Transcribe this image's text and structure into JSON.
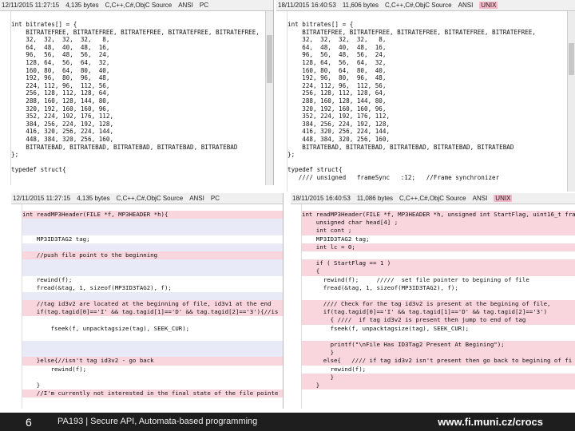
{
  "top_left": {
    "status": {
      "date": "12/11/2015 11:27:15",
      "size": "4,135 bytes",
      "encoding": "C,C++,C#,ObjC Source",
      "charset": "ANSI",
      "eol": "PC"
    },
    "lines": [
      "int bitrates[] = {",
      "    BITRATEFREE, BITRATEFREE, BITRATEFREE, BITRATEFREE, BITRATEFREE,",
      "    32,  32,  32,  32,   8,",
      "    64,  48,  40,  48,  16,",
      "    96,  56,  48,  56,  24,",
      "    128, 64,  56,  64,  32,",
      "    160, 80,  64,  80,  40,",
      "    192, 96,  80,  96,  48,",
      "    224, 112, 96,  112, 56,",
      "    256, 128, 112, 128, 64,",
      "    288, 160, 128, 144, 80,",
      "    320, 192, 160, 160, 96,",
      "    352, 224, 192, 176, 112,",
      "    384, 256, 224, 192, 128,",
      "    416, 320, 256, 224, 144,",
      "    448, 384, 320, 256, 160,",
      "    BITRATEBAD, BITRATEBAD, BITRATEBAD, BITRATEBAD, BITRATEBAD",
      "};",
      "",
      "typedef struct{"
    ]
  },
  "top_right": {
    "status": {
      "date": "18/11/2015 16:40:53",
      "size": "11,606 bytes",
      "encoding": "C,C++,C#,ObjC Source",
      "charset": "ANSI",
      "eol": "UNIX"
    },
    "lines": [
      "int bitrates[] = {",
      "    BITRATEFREE, BITRATEFREE, BITRATEFREE, BITRATEFREE, BITRATEFREE,",
      "    32,  32,  32,  32,   8,",
      "    64,  48,  40,  48,  16,",
      "    96,  56,  48,  56,  24,",
      "    128, 64,  56,  64,  32,",
      "    160, 80,  64,  80,  40,",
      "    192, 96,  80,  96,  48,",
      "    224, 112, 96,  112, 56,",
      "    256, 128, 112, 128, 64,",
      "    288, 160, 128, 144, 80,",
      "    320, 192, 160, 160, 96,",
      "    352, 224, 192, 176, 112,",
      "    384, 256, 224, 192, 128,",
      "    416, 320, 256, 224, 144,",
      "    448, 384, 320, 256, 160,",
      "    BITRATEBAD, BITRATEBAD, BITRATEBAD, BITRATEBAD, BITRATEBAD",
      "};",
      "",
      "typedef struct{",
      "   //// unsigned   frameSync   :12;   //Frame synchronizer"
    ]
  },
  "bottom_left": {
    "status": {
      "date": "12/11/2015 11:27:15",
      "size": "4,135 bytes",
      "encoding": "C,C++,C#,ObjC Source",
      "charset": "ANSI",
      "eol": "PC"
    },
    "lines": [
      {
        "t": "int readMP3Header(FILE *f, MP3HEADER *h){",
        "c": "diff"
      },
      {
        "t": "",
        "c": "blank"
      },
      {
        "t": "",
        "c": "blank"
      },
      {
        "t": "    MP3ID3TAG2 tag;",
        "c": ""
      },
      {
        "t": "",
        "c": "blank"
      },
      {
        "t": "    //push file point to the beginning",
        "c": "diff"
      },
      {
        "t": "",
        "c": "blank"
      },
      {
        "t": "",
        "c": "blank"
      },
      {
        "t": "    rewind(f);",
        "c": ""
      },
      {
        "t": "    fread(&tag, 1, sizeof(MP3ID3TAG2), f);",
        "c": ""
      },
      {
        "t": "",
        "c": "blank"
      },
      {
        "t": "    //tag id3v2 are located at the beginning of file, id3v1 at the end",
        "c": "diff"
      },
      {
        "t": "    if(tag.tagid[0]=='I' && tag.tagid[1]=='D' && tag.tagid[2]=='3'){//is",
        "c": "diff"
      },
      {
        "t": "",
        "c": ""
      },
      {
        "t": "        fseek(f, unpacktagsize(tag), SEEK_CUR);",
        "c": ""
      },
      {
        "t": "",
        "c": ""
      },
      {
        "t": "",
        "c": "blank"
      },
      {
        "t": "",
        "c": "blank"
      },
      {
        "t": "    }else{//isn't tag id3v2 - go back",
        "c": "diff"
      },
      {
        "t": "        rewind(f);",
        "c": ""
      },
      {
        "t": "",
        "c": ""
      },
      {
        "t": "    }",
        "c": ""
      },
      {
        "t": "    //I'm currently not interested in the final state of the file pointe",
        "c": "diff"
      }
    ]
  },
  "bottom_right": {
    "status": {
      "date": "18/11/2015 16:40:53",
      "size": "11,086 bytes",
      "encoding": "C,C++,C#,ObjC Source",
      "charset": "ANSI",
      "eol": "UNIX"
    },
    "lines": [
      {
        "t": "int readMP3Header(FILE *f, MP3HEADER *h, unsigned int StartFlag, uint16_t fra",
        "c": "diff"
      },
      {
        "t": "    unsigned char head[4] ;",
        "c": "diff"
      },
      {
        "t": "    int cont ;",
        "c": "diff"
      },
      {
        "t": "    MP3ID3TAG2 tag;",
        "c": ""
      },
      {
        "t": "    int lc = 0;",
        "c": "diff"
      },
      {
        "t": "",
        "c": ""
      },
      {
        "t": "    if ( StartFlag == 1 )",
        "c": "diff"
      },
      {
        "t": "    {",
        "c": "diff"
      },
      {
        "t": "      rewind(f);     /////  set file pointer to begining of file",
        "c": ""
      },
      {
        "t": "      fread(&tag, 1, sizeof(MP3ID3TAG2), f);",
        "c": ""
      },
      {
        "t": "",
        "c": ""
      },
      {
        "t": "      //// Check for the tag id3v2 is present at the begining of file,",
        "c": "diff"
      },
      {
        "t": "      if(tag.tagid[0]=='I' && tag.tagid[1]=='D' && tag.tagid[2]=='3')",
        "c": "diff"
      },
      {
        "t": "        { ////  if tag id3v2 is present then jump to end of tag",
        "c": "diff"
      },
      {
        "t": "        fseek(f, unpacktagsize(tag), SEEK_CUR);",
        "c": ""
      },
      {
        "t": "",
        "c": ""
      },
      {
        "t": "        printf(\"\\nFile Has ID3Tag2 Present At Begining\");",
        "c": "diff"
      },
      {
        "t": "        }",
        "c": "diff"
      },
      {
        "t": "      else{   //// if tag id3v2 isn't present then go back to begining of fi",
        "c": "diff"
      },
      {
        "t": "        rewind(f);",
        "c": ""
      },
      {
        "t": "        }",
        "c": "diff"
      },
      {
        "t": "    }",
        "c": "diff"
      }
    ]
  },
  "footer": {
    "slide_number": "6",
    "title": "PA193 | Secure API, Automata-based programming",
    "url": "www.fi.muni.cz/crocs"
  }
}
